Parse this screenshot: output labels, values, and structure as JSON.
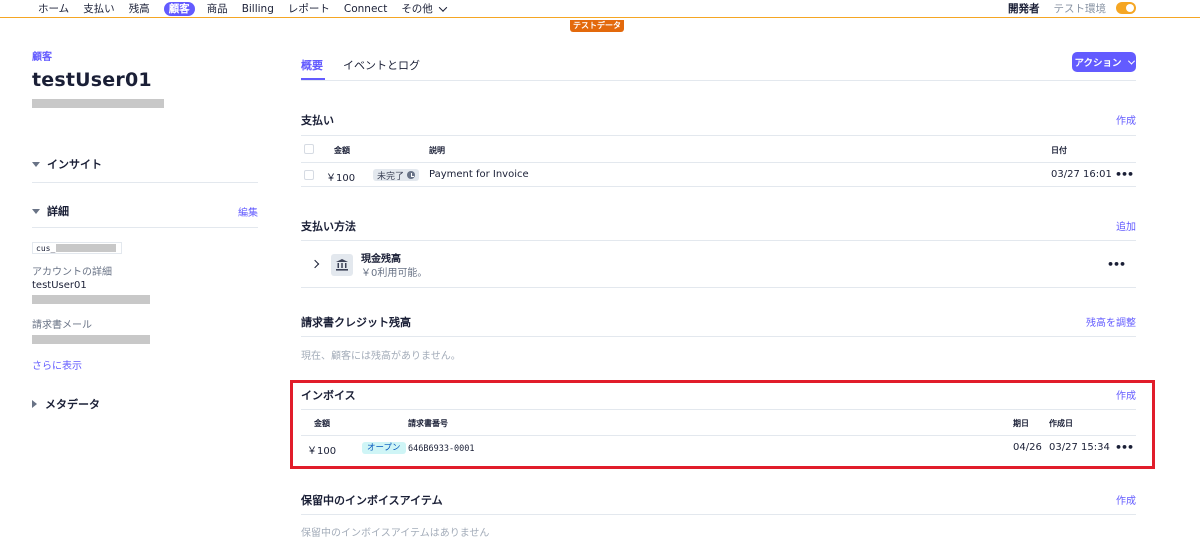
{
  "nav": {
    "items": [
      "ホーム",
      "支払い",
      "残高",
      "顧客",
      "商品",
      "Billing",
      "レポート",
      "Connect"
    ],
    "active_index": 3,
    "more_label": "その他",
    "developer_label": "開発者",
    "env_label": "テスト環境",
    "test_badge": "テストデータ"
  },
  "customer": {
    "breadcrumb": "顧客",
    "name": "testUser01",
    "insight_label": "インサイト",
    "details_label": "詳細",
    "edit_label": "編集",
    "id_prefix": "cus_",
    "account_label": "アカウントの詳細",
    "account_value": "testUser01",
    "invoice_email_label": "請求書メール",
    "show_more": "さらに表示",
    "metadata_label": "メタデータ"
  },
  "tabs": [
    "概要",
    "イベントとログ"
  ],
  "action_button": "アクション",
  "payments": {
    "title": "支払い",
    "link": "作成",
    "headers": {
      "amount": "金額",
      "description": "説明",
      "date": "日付"
    },
    "rows": [
      {
        "amount": "￥100",
        "status": "未完了",
        "description": "Payment for Invoice",
        "date": "03/27 16:01"
      }
    ]
  },
  "payment_methods": {
    "title": "支払い方法",
    "link": "追加",
    "method_name": "現金残高",
    "method_sub": "￥0利用可能。"
  },
  "credit_balance": {
    "title": "請求書クレジット残高",
    "link": "残高を調整",
    "empty": "現在、顧客には残高がありません。"
  },
  "invoices": {
    "title": "インボイス",
    "link": "作成",
    "headers": {
      "amount": "金額",
      "number": "請求書番号",
      "due": "期日",
      "created": "作成日"
    },
    "rows": [
      {
        "amount": "￥100",
        "status": "オープン",
        "number": "646B6933-0001",
        "due": "04/26",
        "created": "03/27 15:34"
      }
    ]
  },
  "pending_items": {
    "title": "保留中のインボイスアイテム",
    "link": "作成",
    "empty": "保留中のインボイスアイテムはありません"
  },
  "colors": {
    "accent": "#635bff",
    "test_orange": "#e3690c",
    "highlight_red": "#e11d2a"
  }
}
